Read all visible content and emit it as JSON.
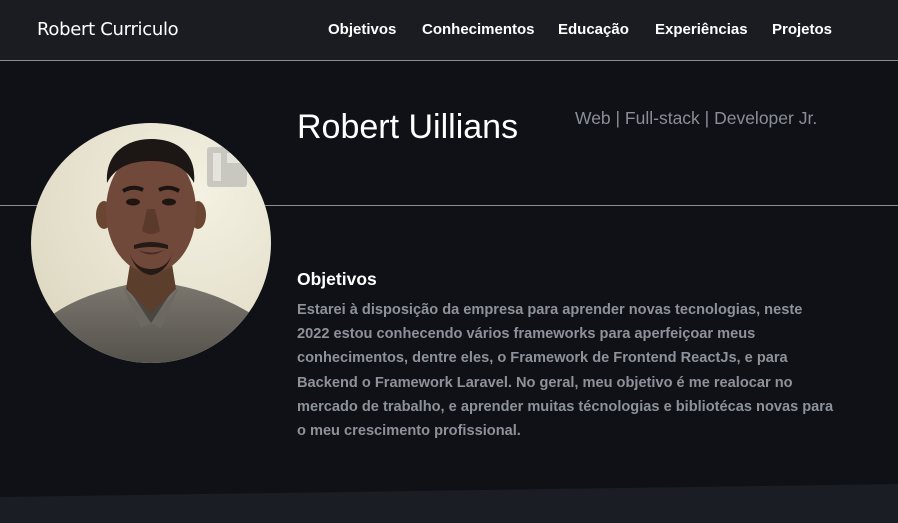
{
  "navbar": {
    "brand": "Robert Curriculo",
    "links": [
      {
        "label": "Objetivos"
      },
      {
        "label": "Conhecimentos"
      },
      {
        "label": "Educação"
      },
      {
        "label": "Experiências"
      },
      {
        "label": "Projetos"
      }
    ]
  },
  "profile": {
    "name": "Robert Uillians",
    "role": "Web | Full-stack | Developer Jr."
  },
  "objetivos": {
    "title": "Objetivos",
    "text": "Estarei à disposição da empresa para aprender novas tecnologias, neste 2022 estou conhecendo vários frameworks para aperfeiçoar meus conhecimentos, dentre eles, o Framework de Frontend ReactJs, e para Backend o Framework Laravel. No geral, meu objetivo é me realocar no mercado de trabalho, e aprender muitas técnologias e bibliotécas novas para o meu crescimento profissional."
  },
  "colors": {
    "background": "#0f1117",
    "navbar": "#1a1c22",
    "muted_text": "#8d929a",
    "divider": "#8a8c92"
  }
}
